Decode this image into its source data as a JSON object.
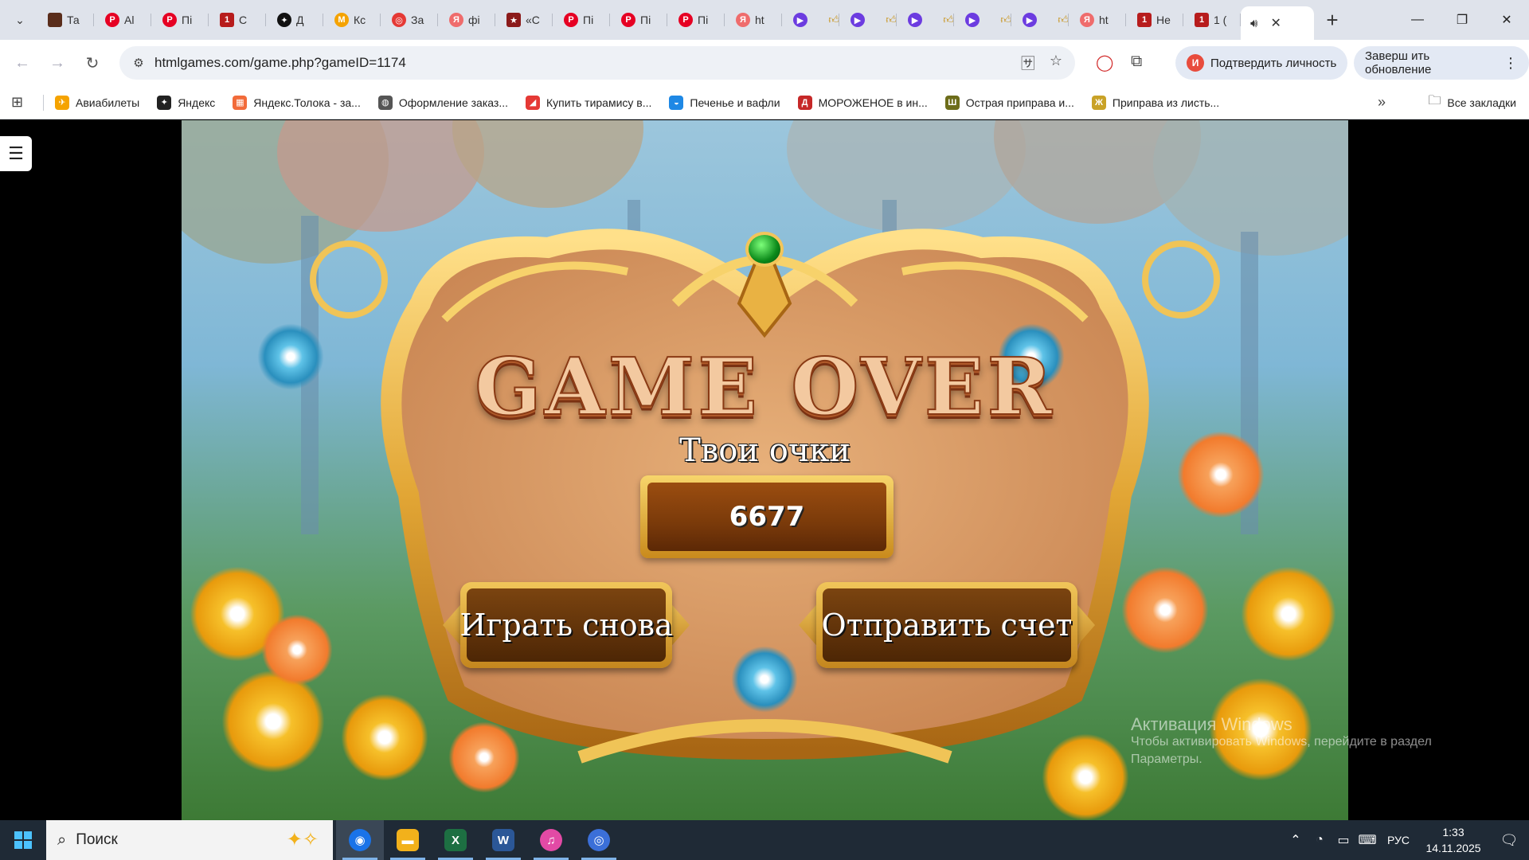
{
  "tabs": [
    {
      "label": "Та",
      "color": "#5a2d1b",
      "glyph": ""
    },
    {
      "label": "Al",
      "color": "#e60023",
      "glyph": "P"
    },
    {
      "label": "Пі",
      "color": "#e60023",
      "glyph": "P"
    },
    {
      "label": "С",
      "color": "#b71c1c",
      "glyph": "1"
    },
    {
      "label": "Д",
      "color": "#111111",
      "glyph": "✦"
    },
    {
      "label": "Кс",
      "color": "#f5a300",
      "glyph": "M"
    },
    {
      "label": "За",
      "color": "#e53935",
      "glyph": "◎"
    },
    {
      "label": "фі",
      "color": "#ef6c6c",
      "glyph": "Я"
    },
    {
      "label": "«С",
      "color": "#8b1a1a",
      "glyph": "★"
    },
    {
      "label": "Пі",
      "color": "#e60023",
      "glyph": "P"
    },
    {
      "label": "Пі",
      "color": "#e60023",
      "glyph": "P"
    },
    {
      "label": "Пі",
      "color": "#e60023",
      "glyph": "P"
    },
    {
      "label": "ht",
      "color": "#ef6c6c",
      "glyph": "Я"
    },
    {
      "label": "",
      "color": "#6c3ce0",
      "glyph": "▶"
    },
    {
      "label": "",
      "color": "#6c3ce0",
      "glyph": "▶"
    },
    {
      "label": "",
      "color": "#6c3ce0",
      "glyph": "▶"
    },
    {
      "label": "",
      "color": "#6c3ce0",
      "glyph": "▶"
    },
    {
      "label": "",
      "color": "#6c3ce0",
      "glyph": "▶"
    },
    {
      "label": "ht",
      "color": "#ef6c6c",
      "glyph": "Я"
    },
    {
      "label": "Не",
      "color": "#b71c1c",
      "glyph": "1"
    },
    {
      "label": "1 (",
      "color": "#b71c1c",
      "glyph": "1"
    }
  ],
  "active_tab": {
    "icon": "speaker-icon",
    "close": "✕"
  },
  "window_controls": {
    "minimize": "—",
    "maximize": "❐",
    "close": "✕"
  },
  "toolbar": {
    "url": "htmlgames.com/game.php?gameID=1174",
    "verify_label": "Подтвердить личность",
    "verify_avatar": "И",
    "update_label": "Заверш ить обновление"
  },
  "bookmarks": [
    {
      "label": "Авиабилеты",
      "color": "#f5a300",
      "glyph": "✈"
    },
    {
      "label": "Яндекс",
      "color": "#222222",
      "glyph": "✦"
    },
    {
      "label": "Яндекс.Толока - за...",
      "color": "#f26b3a",
      "glyph": "▦"
    },
    {
      "label": "Оформление заказ...",
      "color": "#555555",
      "glyph": "◍"
    },
    {
      "label": "Купить тирамису в...",
      "color": "#e53935",
      "glyph": "◢"
    },
    {
      "label": "Печенье и вафли",
      "color": "#1e88e5",
      "glyph": "◒"
    },
    {
      "label": "МОРОЖЕНОЕ в ин...",
      "color": "#c62828",
      "glyph": "Д"
    },
    {
      "label": "Острая приправа и...",
      "color": "#6d6d1a",
      "glyph": "Ш"
    },
    {
      "label": "Приправа из листь...",
      "color": "#c9a227",
      "glyph": "Ж"
    }
  ],
  "bookmarks_all": "Все закладки",
  "game": {
    "title": "GAME OVER",
    "score_label": "Твои очки",
    "score": "6677",
    "play_again": "Играть снова",
    "submit_score": "Отправить счет"
  },
  "activation": {
    "title": "Активация Windows",
    "line1": "Чтобы активировать Windows, перейдите в раздел",
    "line2": "Параметры."
  },
  "taskbar": {
    "search_placeholder": "Поиск",
    "apps": [
      {
        "name": "chrome",
        "color": "#1a73e8",
        "glyph": "◉",
        "active": true
      },
      {
        "name": "explorer",
        "color": "#f2b11b",
        "glyph": "▬",
        "active": false
      },
      {
        "name": "excel",
        "color": "#1d6f42",
        "glyph": "X",
        "active": false
      },
      {
        "name": "word",
        "color": "#2b5797",
        "glyph": "W",
        "active": false
      },
      {
        "name": "itunes",
        "color": "#e24aa5",
        "glyph": "♫",
        "active": false
      },
      {
        "name": "app",
        "color": "#3b6fd8",
        "glyph": "◎",
        "active": false
      }
    ],
    "lang": "РУС",
    "time": "1:33",
    "date": "14.11.2025"
  },
  "colors": {
    "gold": "#f1c65a",
    "brown": "#7b4410",
    "title": "#f3c9a0"
  }
}
